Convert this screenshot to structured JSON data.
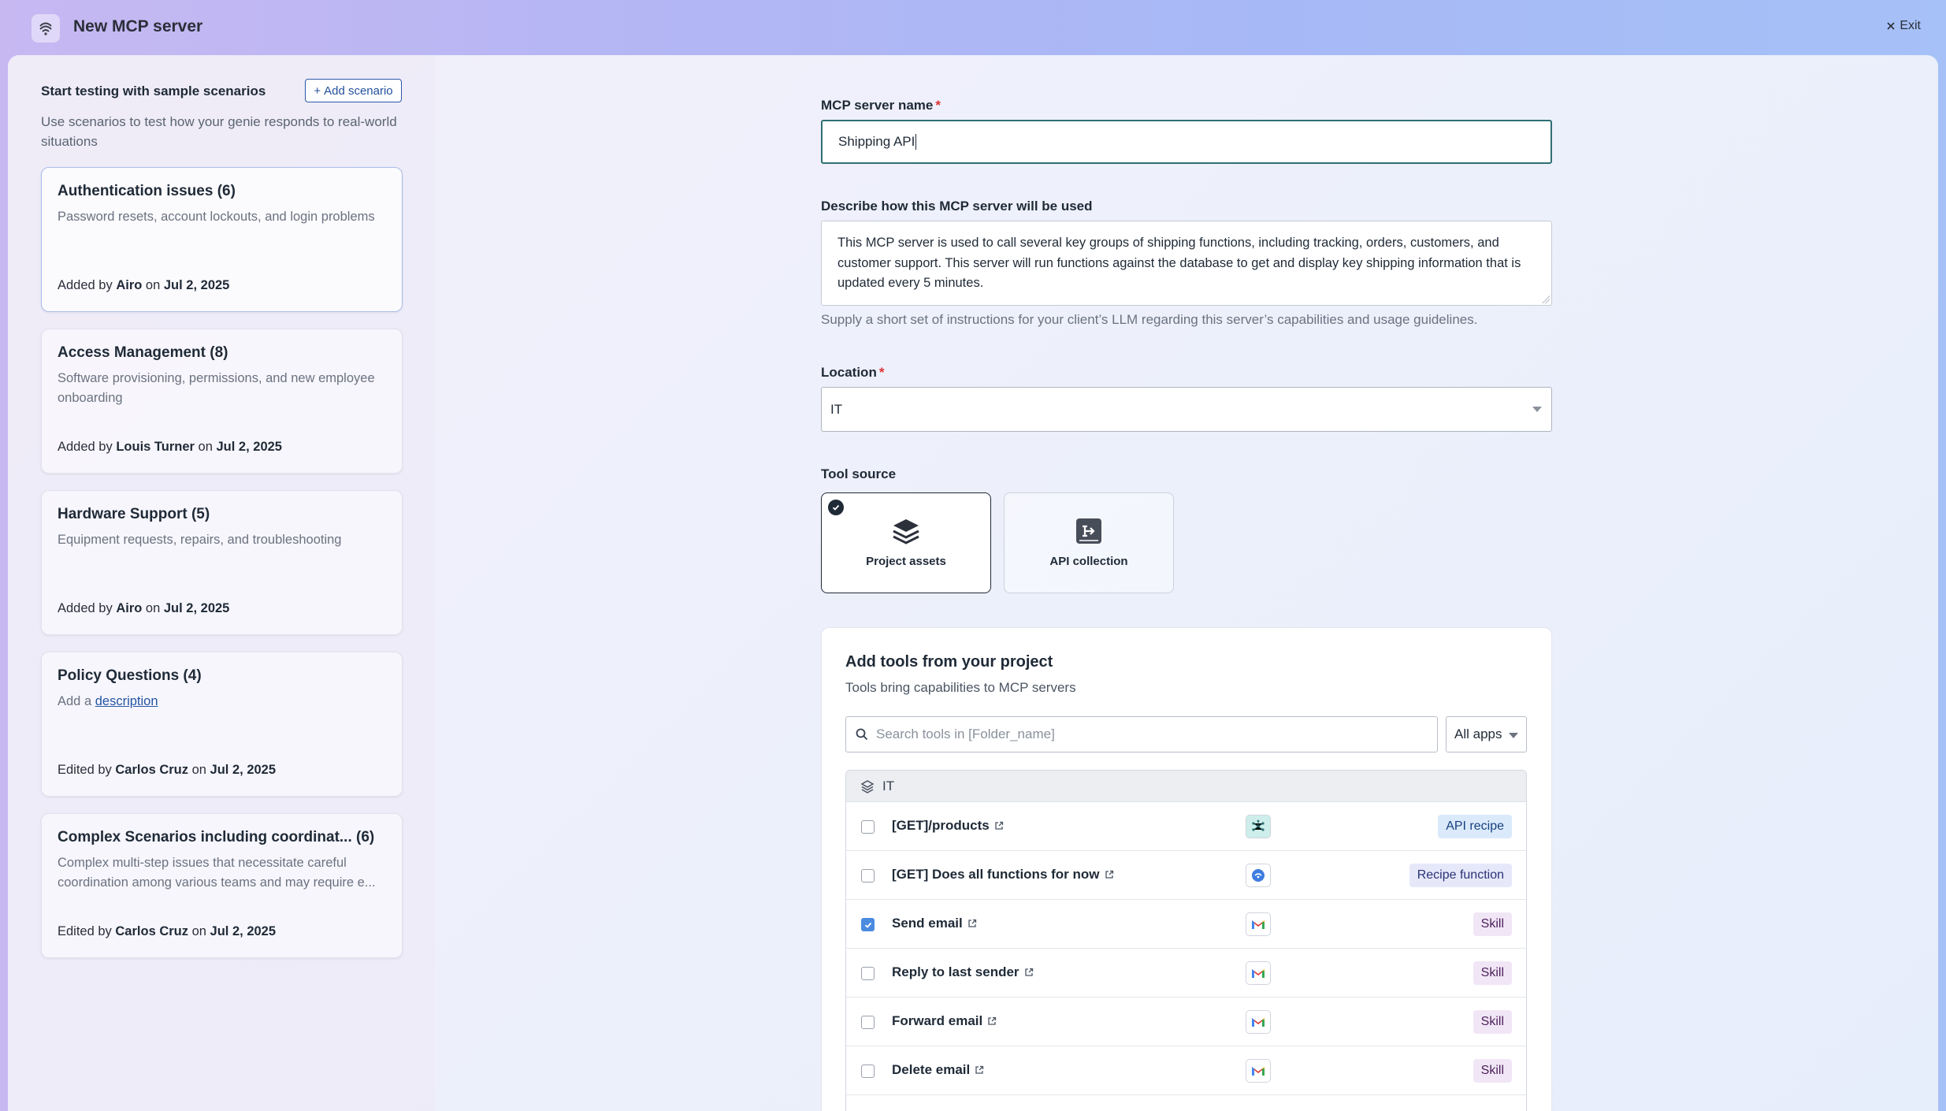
{
  "window": {
    "title": "New MCP server",
    "exit_label": "Exit"
  },
  "scenarios": {
    "heading": "Start testing with sample scenarios",
    "add_button": "Add scenario",
    "description": "Use scenarios to test how your genie responds to real-world situations",
    "cards": [
      {
        "title": "Authentication issues (6)",
        "desc": "Password resets, account lockouts, and login problems",
        "verb": "Added by",
        "author": "Airo",
        "on": "on",
        "date": "Jul 2, 2025"
      },
      {
        "title": "Access Management (8)",
        "desc": "Software provisioning, permissions, and new employee onboarding",
        "verb": "Added by",
        "author": "Louis Turner",
        "on": "on",
        "date": "Jul 2, 2025"
      },
      {
        "title": "Hardware Support (5)",
        "desc": "Equipment requests, repairs, and troubleshooting",
        "verb": "Added by",
        "author": "Airo",
        "on": "on",
        "date": "Jul 2, 2025"
      },
      {
        "title": "Policy Questions (4)",
        "desc_prefix": "Add a",
        "desc_link": "description",
        "verb": "Edited by",
        "author": "Carlos Cruz",
        "on": "on",
        "date": "Jul 2, 2025"
      },
      {
        "title": "Complex Scenarios including coordinat... (6)",
        "desc": "Complex multi-step issues that necessitate careful coordination among various teams and may require e...",
        "verb": "Edited by",
        "author": "Carlos Cruz",
        "on": "on",
        "date": "Jul 2, 2025"
      }
    ]
  },
  "form": {
    "name_label": "MCP server name",
    "name_value": "Shipping API",
    "required_mark": "*",
    "describe_label": "Describe how this MCP server will be used",
    "describe_value": "This MCP server is used to call several key groups of shipping functions, including tracking, orders, customers, and customer support. This server will run functions against the database to get and display key shipping information that is updated every 5 minutes.",
    "describe_hint": "Supply a short set of instructions for your client’s LLM regarding this server’s capabilities and usage guidelines.",
    "location_label": "Location",
    "location_value": "IT",
    "tool_source_label": "Tool source",
    "tool_sources": [
      {
        "label": "Project assets",
        "selected": true
      },
      {
        "label": "API collection",
        "selected": false
      }
    ]
  },
  "tools": {
    "title": "Add tools from your project",
    "subtitle": "Tools bring capabilities to MCP servers",
    "search_placeholder": "Search tools in [Folder_name]",
    "apps_filter": "All apps",
    "group": "IT",
    "rows": [
      {
        "name": "[GET]/products",
        "app": "api-icon",
        "type": "API recipe",
        "checked": false
      },
      {
        "name": "[GET] Does all functions for now",
        "app": "workato-icon",
        "type": "Recipe function",
        "checked": false
      },
      {
        "name": "Send email",
        "app": "gmail-icon",
        "type": "Skill",
        "checked": true
      },
      {
        "name": "Reply to last sender",
        "app": "gmail-icon",
        "type": "Skill",
        "checked": false
      },
      {
        "name": "Forward email",
        "app": "gmail-icon",
        "type": "Skill",
        "checked": false
      },
      {
        "name": "Delete email",
        "app": "gmail-icon",
        "type": "Skill",
        "checked": false
      }
    ]
  },
  "colors": {
    "accent": "#2455a4",
    "selected_border": "#1f2a37",
    "name_input_border": "#2f6f73",
    "checkbox_checked": "#4a8be0"
  }
}
